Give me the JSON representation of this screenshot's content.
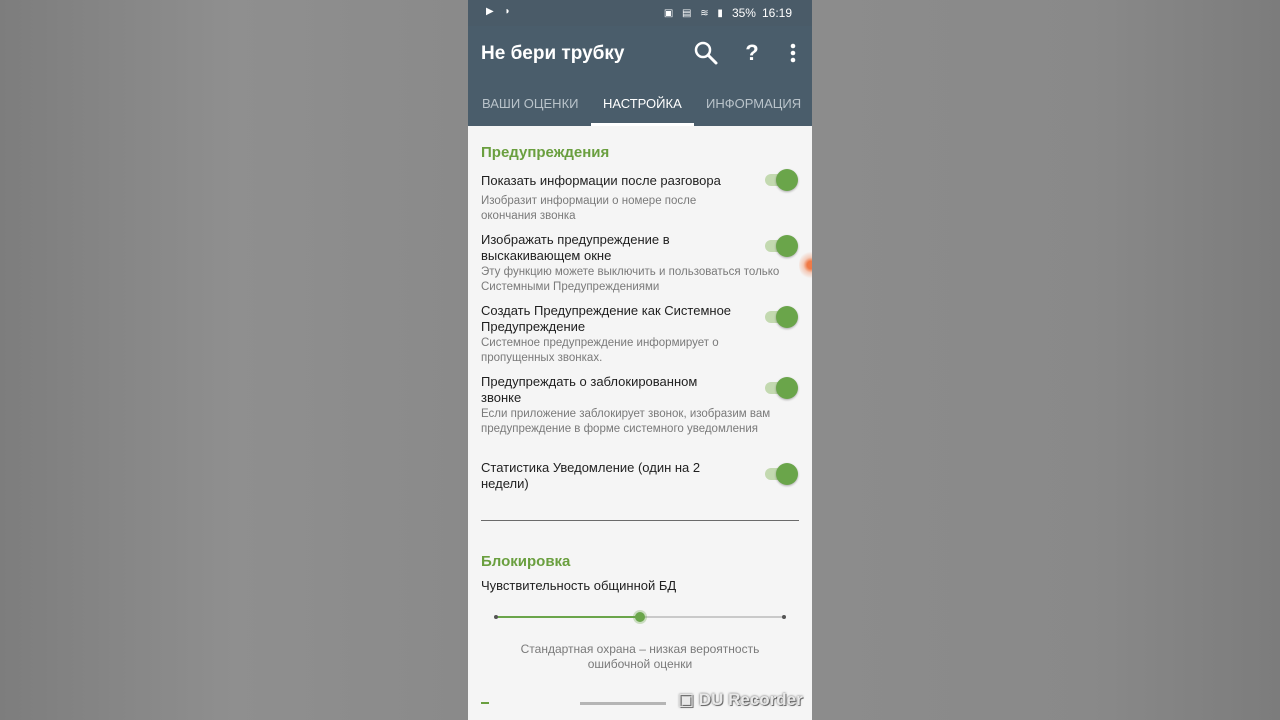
{
  "status_bar": {
    "battery": "35%",
    "time": "16:19"
  },
  "app": {
    "title": "Не бери трубку"
  },
  "tabs": [
    {
      "label": "ВАШИ ОЦЕНКИ",
      "selected": false
    },
    {
      "label": "НАСТРОЙКА",
      "selected": true
    },
    {
      "label": "ИНФОРМАЦИЯ",
      "selected": false
    }
  ],
  "warnings": {
    "title": "Предупреждения",
    "items": [
      {
        "title": "Показать информации после разговора",
        "subtitle": "Изобразит информации о номере после окончания звонка",
        "enabled": true
      },
      {
        "title": "Изображать предупреждение в выскакивающем окне",
        "subtitle": "Эту функцию можете выключить и пользоваться только Системными Предупреждениями",
        "enabled": true
      },
      {
        "title": "Создать Предупреждение как Системное Предупреждение",
        "subtitle": "Системное предупреждение информирует о пропущенных звонках.",
        "enabled": true
      },
      {
        "title": "Предупреждать о заблокированном звонке",
        "subtitle": "Если приложение заблокирует звонок, изобразим вам предупреждение в форме системного уведомления",
        "enabled": true
      },
      {
        "title": "Статистика Уведомление (один на 2 недели)",
        "subtitle": "",
        "enabled": true
      }
    ]
  },
  "blocking": {
    "title": "Блокировка",
    "sensitivity_label": "Чувствительность общинной БД",
    "sensitivity_level": 0.5,
    "caption": "Стандартная охрана – низкая вероятность ошибочной оценки"
  },
  "watermark": "DU Recorder",
  "colors": {
    "app_bar": "#4a5d6b",
    "accent": "#6aa54a",
    "section_title": "#6a9f3f"
  }
}
